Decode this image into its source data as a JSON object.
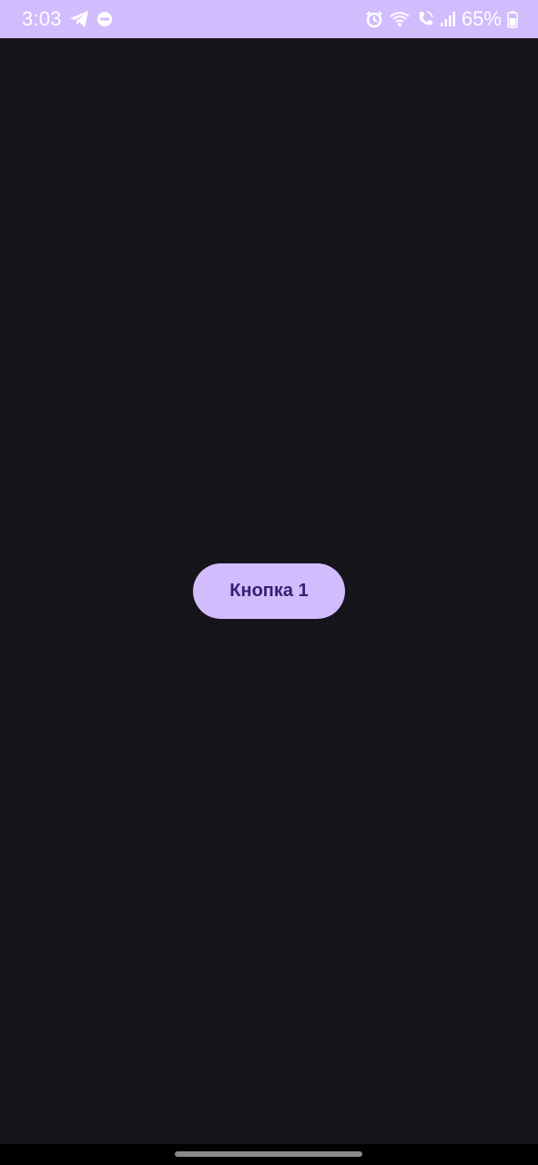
{
  "status_bar": {
    "time": "3:03",
    "battery_percent": "65%",
    "left_icons": [
      "telegram-icon",
      "do-not-disturb-icon"
    ],
    "right_icons": [
      "alarm-icon",
      "wifi-calling-icon",
      "volte-call-icon",
      "signal-icon",
      "battery-icon"
    ],
    "background_color": "#d1bcfd"
  },
  "main": {
    "button_label": "Кнопка 1",
    "background_color": "#16141b",
    "button_color": "#d1bcfd",
    "button_text_color": "#381e72"
  },
  "nav_bar": {
    "home_indicator": "gesture-handle"
  }
}
